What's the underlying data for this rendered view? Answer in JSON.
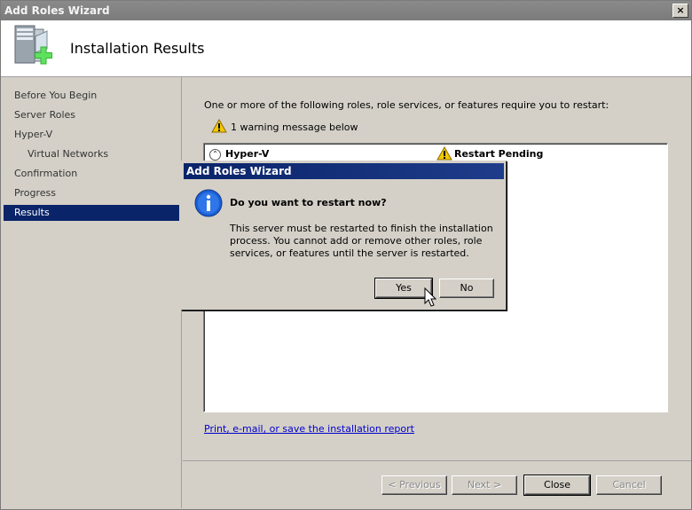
{
  "window": {
    "title": "Add Roles Wizard",
    "close_glyph": "×"
  },
  "header": {
    "title": "Installation Results",
    "icon": "server-add-icon"
  },
  "sidebar": {
    "items": [
      {
        "label": "Before You Begin"
      },
      {
        "label": "Server Roles"
      },
      {
        "label": "Hyper-V"
      },
      {
        "label": "Virtual Networks"
      },
      {
        "label": "Confirmation"
      },
      {
        "label": "Progress"
      },
      {
        "label": "Results"
      }
    ],
    "active_index": 6
  },
  "main": {
    "intro": "One or more of the following roles, role services, or features require you to restart:",
    "warning_summary": "1 warning message below",
    "results": [
      {
        "role": "Hyper-V",
        "status": "Restart Pending",
        "status_icon": "warning-icon"
      }
    ],
    "report_link": "Print, e-mail, or save the installation report"
  },
  "footer": {
    "previous_label": "< Previous",
    "next_label": "Next >",
    "close_label": "Close",
    "cancel_label": "Cancel"
  },
  "dialog": {
    "title": "Add Roles Wizard",
    "question": "Do you want to restart now?",
    "message": "This server must be restarted to finish the installation process. You cannot add or remove other roles, role services, or features until the server is restarted.",
    "yes_label": "Yes",
    "no_label": "No",
    "icon": "info-icon"
  },
  "colors": {
    "selection": "#0a246a",
    "link": "#0000cc",
    "warning": "#f5c800",
    "info": "#1c5fd6"
  }
}
